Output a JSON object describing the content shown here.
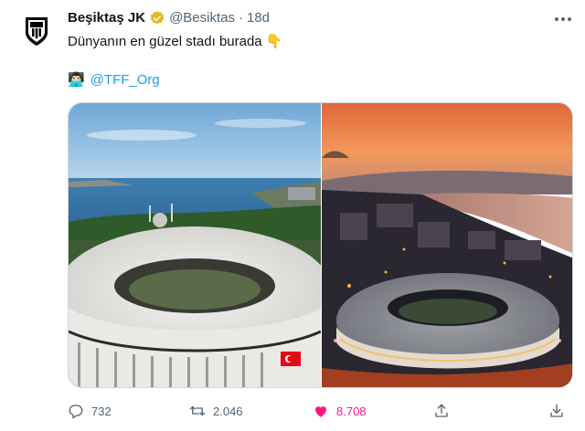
{
  "tweet": {
    "display_name": "Beşiktaş JK",
    "handle": "@Besiktas",
    "separator": "·",
    "time": "18d",
    "text": "Dünyanın en güzel stadı burada 👇",
    "mention_emoji": "👨🏻‍💻",
    "mention": "@TFF_Org"
  },
  "media": [
    {
      "name": "stadium-daytime-photo"
    },
    {
      "name": "stadium-sunset-photo"
    }
  ],
  "actions": {
    "reply_count": "732",
    "retweet_count": "2.046",
    "like_count": "8.708"
  },
  "colors": {
    "accent": "#1d9bf0",
    "like": "#f91880",
    "muted": "#536471",
    "verified": "#e2b719"
  }
}
